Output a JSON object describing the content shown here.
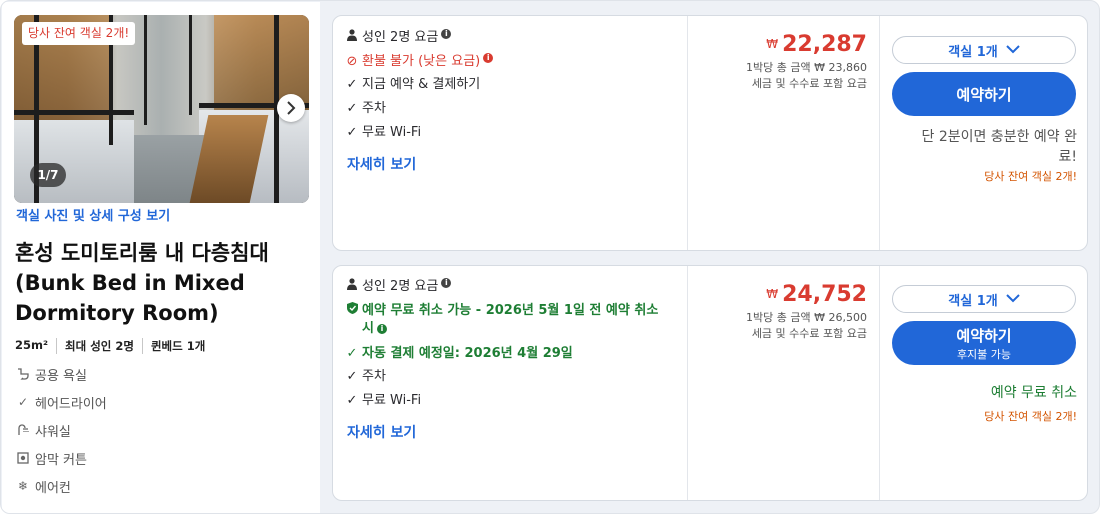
{
  "room": {
    "availability_badge": "당사 잔여 객실 2개!",
    "photo_counter": "1/7",
    "photos_link": "객실 사진 및 상세 구성 보기",
    "title": "혼성 도미토리룸 내 다층침대 (Bunk Bed in Mixed Dormitory Room)",
    "specs": [
      "25m²",
      "최대 성인 2명",
      "퀸베드 1개"
    ],
    "amenities": [
      {
        "icon": "toilet-icon",
        "label": "공용 욕실"
      },
      {
        "icon": "check-icon",
        "label": "헤어드라이어"
      },
      {
        "icon": "shower-icon",
        "label": "샤워실"
      },
      {
        "icon": "blackout-curtain-icon",
        "label": "암막 커튼"
      },
      {
        "icon": "snowflake-icon",
        "label": "에어컨"
      }
    ]
  },
  "offers": [
    {
      "occupancy": "성인 2명 요금",
      "policy": "환불 불가 (낮은 요금)",
      "features": [
        "지금 예약 & 결제하기",
        "주차",
        "무료 Wi-Fi"
      ],
      "details_link": "자세히 보기",
      "currency": "₩",
      "price": "22,287",
      "total_label": "1박당 총 금액 ₩ 23,860",
      "tax_label": "세금 및 수수료 포함 요금",
      "rooms_select": "객실 1개",
      "book_label": "예약하기",
      "note_main": "단 2분이면 충분한 예약 완료!",
      "note_sub": "당사 잔여 객실 2개!"
    },
    {
      "occupancy": "성인 2명 요금",
      "policy": "예약 무료 취소 가능 - 2026년 5월 1일 전 예약 취소 시",
      "autopay": "자동 결제 예정일: 2026년 4월 29일",
      "features": [
        "주차",
        "무료 Wi-Fi"
      ],
      "details_link": "자세히 보기",
      "currency": "₩",
      "price": "24,752",
      "total_label": "1박당 총 금액 ₩ 26,500",
      "tax_label": "세금 및 수수료 포함 요금",
      "rooms_select": "객실 1개",
      "book_label": "예약하기",
      "book_sub": "후지불 가능",
      "note_main": "예약 무료 취소",
      "note_sub": "당사 잔여 객실 2개!"
    }
  ],
  "colors": {
    "accent": "#2167d8",
    "price": "#d93b30",
    "free_cancel": "#1e7e34",
    "urgency": "#d35400"
  }
}
